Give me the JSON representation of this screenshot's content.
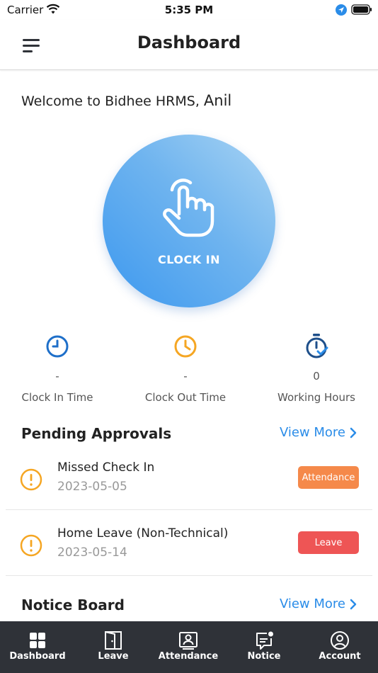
{
  "status_bar": {
    "carrier": "Carrier",
    "time": "5:35 PM"
  },
  "header": {
    "title": "Dashboard"
  },
  "welcome": {
    "text": "Welcome to Bidhee HRMS, ",
    "name": "Anil"
  },
  "clock_in": {
    "label": "CLOCK IN"
  },
  "stats": [
    {
      "value": "-",
      "label": "Clock In Time",
      "icon": "clock-icon",
      "color": "#1e6fc9"
    },
    {
      "value": "-",
      "label": "Clock Out Time",
      "icon": "clock-icon",
      "color": "#f5a623"
    },
    {
      "value": "0",
      "label": "Working Hours",
      "icon": "stopwatch-icon",
      "color": "#1e4f8a"
    }
  ],
  "pending": {
    "title": "Pending Approvals",
    "view_more": "View More",
    "items": [
      {
        "title": "Missed Check In",
        "date": "2023-05-05",
        "badge": "Attendance",
        "badge_color": "#f5894a"
      },
      {
        "title": "Home Leave (Non-Technical)",
        "date": "2023-05-14",
        "badge": "Leave",
        "badge_color": "#ee5555"
      }
    ]
  },
  "notice": {
    "title": "Notice Board",
    "view_more": "View More"
  },
  "nav": [
    {
      "label": "Dashboard",
      "icon": "grid-icon"
    },
    {
      "label": "Leave",
      "icon": "door-icon"
    },
    {
      "label": "Attendance",
      "icon": "id-card-icon"
    },
    {
      "label": "Notice",
      "icon": "notice-icon"
    },
    {
      "label": "Account",
      "icon": "account-icon"
    }
  ],
  "colors": {
    "accent": "#2a8ce8",
    "warning": "#f5a623",
    "nav_bg": "#2f3238"
  }
}
